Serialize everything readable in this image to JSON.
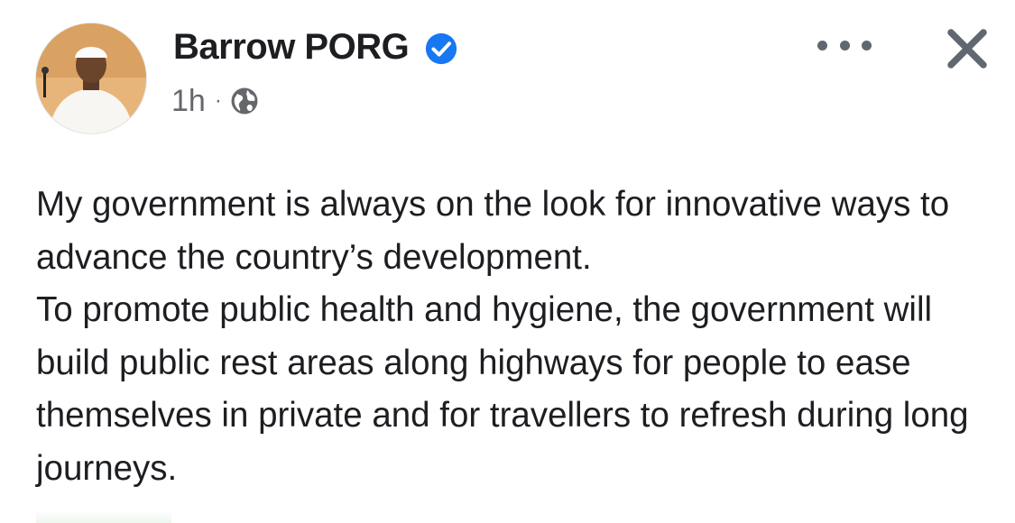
{
  "post": {
    "author": {
      "name": "Barrow PORG",
      "verified": true,
      "avatar_icon": "profile-photo"
    },
    "meta": {
      "time": "1h",
      "separator": "·",
      "audience_icon": "globe-icon"
    },
    "actions": {
      "more_icon": "more-options-icon",
      "close_icon": "close-icon"
    },
    "text": {
      "paragraph_1": "My government is always on the look for innovative ways to advance the country’s development.",
      "paragraph_2": "To promote public health and hygiene, the government will build public rest areas along highways for people to ease themselves in private and for travellers to refresh during long journeys."
    }
  },
  "colors": {
    "text": "#1c1e21",
    "secondary_text": "#65676b",
    "verified_blue": "#1877f2",
    "icon_gray": "#606770"
  }
}
